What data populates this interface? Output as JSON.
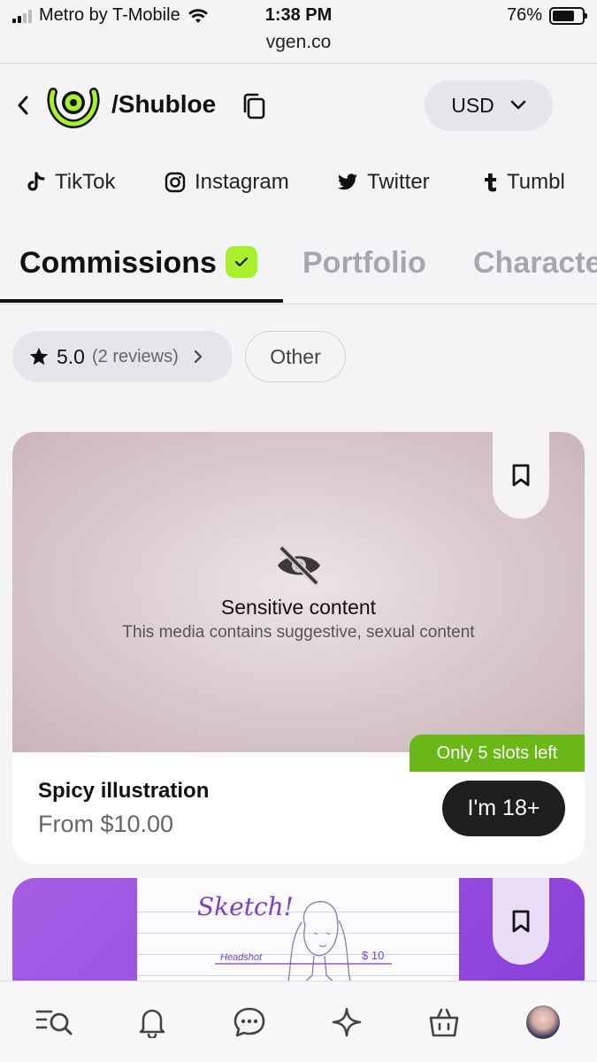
{
  "status_bar": {
    "carrier": "Metro by T-Mobile",
    "time": "1:38 PM",
    "url": "vgen.co",
    "battery": "76%",
    "battery_level": 0.76
  },
  "header": {
    "handle": "/Shubloe",
    "currency": "USD"
  },
  "socials": [
    {
      "label": "TikTok",
      "icon": "tiktok-icon"
    },
    {
      "label": "Instagram",
      "icon": "instagram-icon"
    },
    {
      "label": "Twitter",
      "icon": "twitter-icon"
    },
    {
      "label": "Tumbl",
      "icon": "tumblr-icon"
    }
  ],
  "tabs": [
    {
      "label": "Commissions",
      "active": true
    },
    {
      "label": "Portfolio",
      "active": false
    },
    {
      "label": "Characte",
      "active": false
    }
  ],
  "filters": {
    "rating": "5.0",
    "reviews": "(2 reviews)",
    "other": "Other"
  },
  "cards": [
    {
      "sensitive_title": "Sensitive content",
      "sensitive_desc": "This media contains suggestive, sexual content",
      "slots_badge": "Only 5 slots left",
      "title": "Spicy illustration",
      "price": "From $10.00",
      "action": "I'm 18+"
    },
    {
      "sketch_label": "Sketch!",
      "sketch_caption": "Headshot",
      "sketch_price": "$ 10"
    }
  ],
  "colors": {
    "accent_green": "#a8ef2e",
    "slots_green": "#6ab818",
    "dark_button": "#1f1f21",
    "purple": "#8a3fd8"
  },
  "bottom_nav": [
    "search-list-icon",
    "bell-icon",
    "chat-icon",
    "sparkle-icon",
    "shopping-bag-icon",
    "profile-avatar"
  ]
}
